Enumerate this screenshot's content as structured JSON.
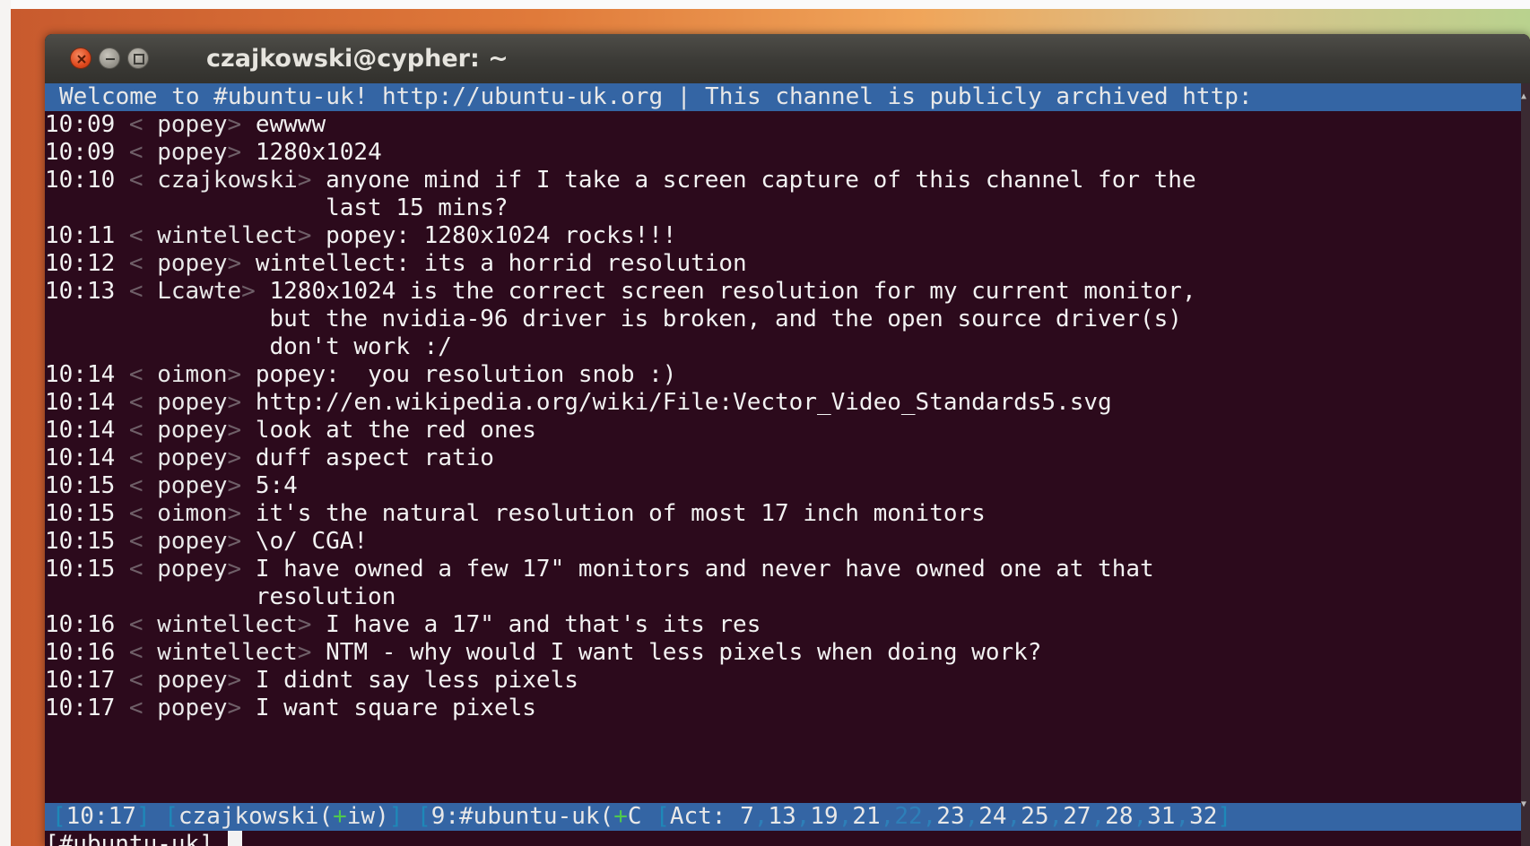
{
  "window": {
    "title": "czajkowski@cypher: ~"
  },
  "topic": "Welcome to #ubuntu-uk! http://ubuntu-uk.org | This channel is publicly archived http:",
  "messages": [
    {
      "time": "10:09",
      "nick": "popey",
      "text": "ewwww"
    },
    {
      "time": "10:09",
      "nick": "popey",
      "text": "1280x1024"
    },
    {
      "time": "10:10",
      "nick": "czajkowski",
      "text": "anyone mind if I take a screen capture of this channel for the",
      "cont": [
        "last 15 mins?"
      ]
    },
    {
      "time": "10:11",
      "nick": "wintellect",
      "text": "popey: 1280x1024 rocks!!!"
    },
    {
      "time": "10:12",
      "nick": "popey",
      "text": "wintellect: its a horrid resolution"
    },
    {
      "time": "10:13",
      "nick": "Lcawte",
      "text": "1280x1024 is the correct screen resolution for my current monitor,",
      "cont": [
        "but the nvidia-96 driver is broken, and the open source driver(s)",
        "don't work :/"
      ]
    },
    {
      "time": "10:14",
      "nick": "oimon",
      "text": "popey:  you resolution snob :)"
    },
    {
      "time": "10:14",
      "nick": "popey",
      "text": "http://en.wikipedia.org/wiki/File:Vector_Video_Standards5.svg"
    },
    {
      "time": "10:14",
      "nick": "popey",
      "text": "look at the red ones"
    },
    {
      "time": "10:14",
      "nick": "popey",
      "text": "duff aspect ratio"
    },
    {
      "time": "10:15",
      "nick": "popey",
      "text": "5:4"
    },
    {
      "time": "10:15",
      "nick": "oimon",
      "text": "it's the natural resolution of most 17 inch monitors"
    },
    {
      "time": "10:15",
      "nick": "popey",
      "text": "\\o/ CGA!"
    },
    {
      "time": "10:15",
      "nick": "popey",
      "text": "I have owned a few 17\" monitors and never have owned one at that",
      "cont": [
        "resolution"
      ]
    },
    {
      "time": "10:16",
      "nick": "wintellect",
      "text": "I have a 17\" and that's its res"
    },
    {
      "time": "10:16",
      "nick": "wintellect",
      "text": "NTM - why would I want less pixels when doing work?"
    },
    {
      "time": "10:17",
      "nick": "popey",
      "text": "I didnt say less pixels"
    },
    {
      "time": "10:17",
      "nick": "popey",
      "text": "I want square pixels"
    }
  ],
  "statusbar": {
    "time": "10:17",
    "nick": "czajkowski",
    "mode_plus": "+",
    "mode": "iw",
    "channel_prefix": "9:#ubuntu-uk(",
    "channel_plus": "+",
    "channel_mode": "C",
    "act_label": "Act: ",
    "act_items": [
      "7",
      "13",
      "19",
      "21",
      "22",
      "23",
      "24",
      "25",
      "27",
      "28",
      "31",
      "32"
    ]
  },
  "prompt": "[#ubuntu-uk] ",
  "icons": {
    "close": "close-icon",
    "minimize": "minimize-icon",
    "maximize": "maximize-icon"
  },
  "colors": {
    "terminal_bg": "#2c0a1c",
    "bar_bg": "#3465a4",
    "highlight_act": "#2d7fb8"
  }
}
